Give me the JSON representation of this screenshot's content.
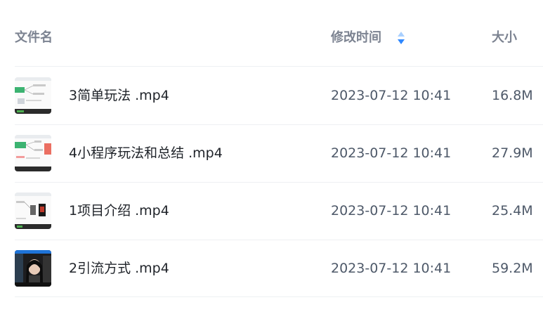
{
  "header": {
    "name_label": "文件名",
    "time_label": "修改时间",
    "size_label": "大小"
  },
  "colors": {
    "sort_active": "#2f88ff",
    "sort_inactive": "#a9d0ff"
  },
  "files": [
    {
      "name": "3简单玩法 .mp4",
      "modified": "2023-07-12 10:41",
      "size": "16.8M",
      "thumbnail": "mindmap-thumbnail"
    },
    {
      "name": "4小程序玩法和总结 .mp4",
      "modified": "2023-07-12 10:41",
      "size": "27.9M",
      "thumbnail": "mindmap-thumbnail"
    },
    {
      "name": "1项目介绍 .mp4",
      "modified": "2023-07-12 10:41",
      "size": "25.4M",
      "thumbnail": "mindmap-phone-thumbnail"
    },
    {
      "name": "2引流方式 .mp4",
      "modified": "2023-07-12 10:41",
      "size": "59.2M",
      "thumbnail": "portrait-video-thumbnail"
    }
  ]
}
